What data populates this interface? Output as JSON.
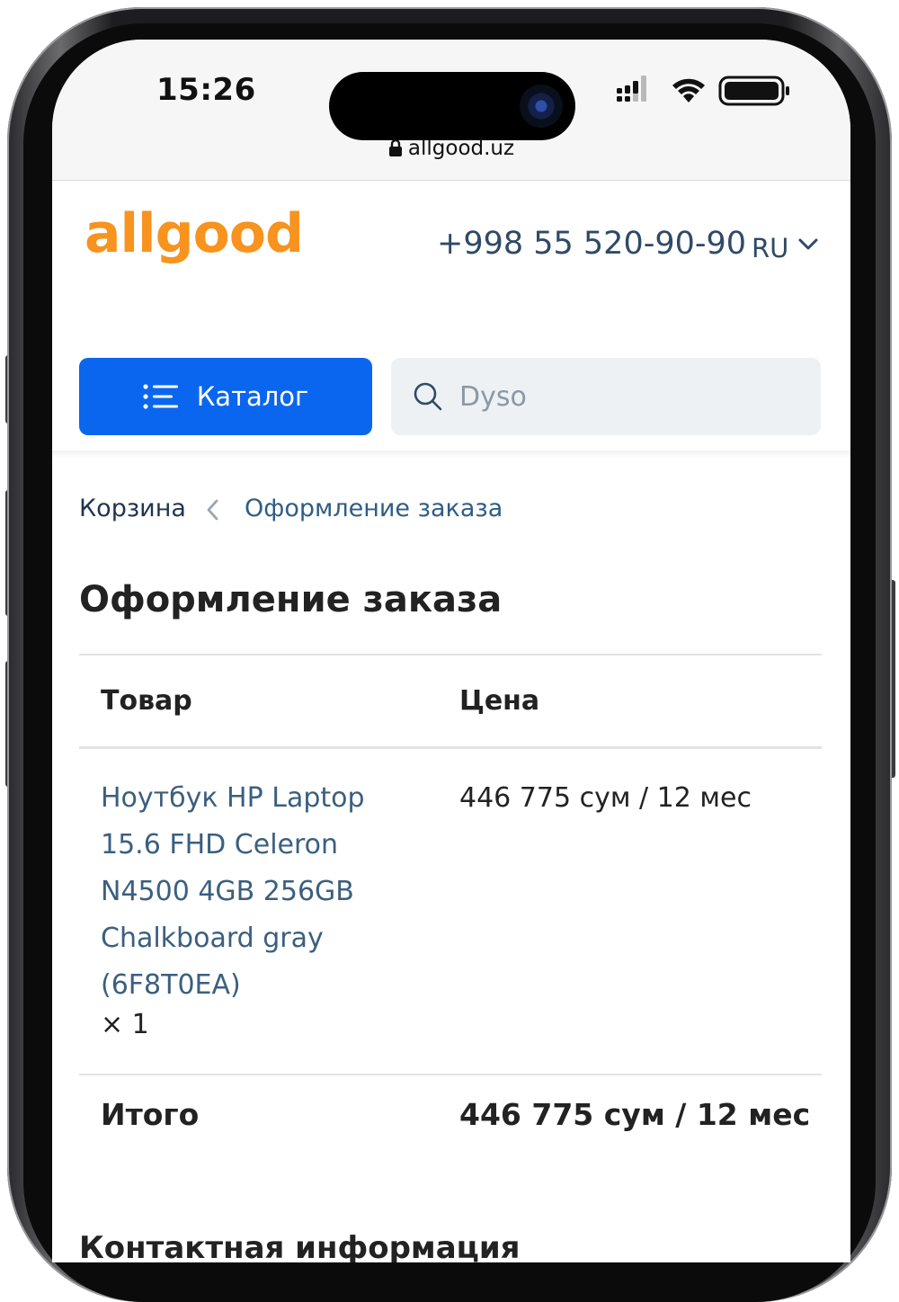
{
  "status_bar": {
    "time": "15:26",
    "url": "allgood.uz"
  },
  "header": {
    "logo_text": "allgood",
    "phone": "+998 55 520-90-90",
    "language": "RU",
    "catalog_label": "Каталог",
    "search_value": "Dyso"
  },
  "breadcrumb": {
    "home": "Корзина",
    "current": "Оформление заказа"
  },
  "page_title": "Оформление заказа",
  "order_table": {
    "col_product": "Товар",
    "col_price": "Цена",
    "items": [
      {
        "name": "Ноутбук HP Laptop 15.6 FHD Celeron N4500 4GB 256GB Chalkboard gray (6F8T0EA)",
        "quantity": "× 1",
        "price": "446 775 сум / 12 мес"
      }
    ],
    "total_label": "Итого",
    "total_value": "446 775 сум / 12 мес"
  },
  "contact_section_title": "Контактная информация",
  "colors": {
    "brand_orange": "#f7931e",
    "catalog_blue": "#0a66ef",
    "link_blue": "#3b5f7f"
  }
}
